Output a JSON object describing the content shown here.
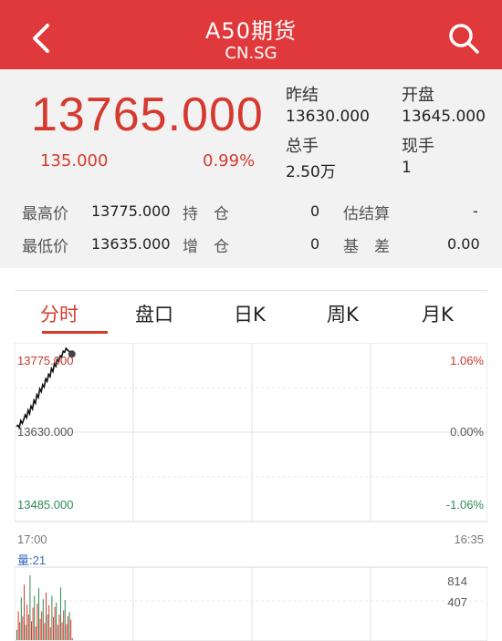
{
  "header": {
    "title": "A50期货",
    "code": "CN.SG"
  },
  "quote": {
    "price": "13765.000",
    "change": "135.000",
    "change_pct": "0.99%",
    "prev_settle_label": "昨结",
    "prev_settle_value": "13630.000",
    "open_label": "开盘",
    "open_value": "13645.000",
    "volume_label": "总手",
    "volume_value": "2.50万",
    "current_label": "现手",
    "current_value": "1"
  },
  "stats": {
    "high_label": "最高价",
    "high_value": "13775.000",
    "position_label": "持　仓",
    "position_value": "0",
    "est_settle_label": "估结算",
    "est_settle_value": "-",
    "low_label": "最低价",
    "low_value": "13635.000",
    "increase_label": "增　仓",
    "increase_value": "0",
    "basis_label": "基　差",
    "basis_value": "0.00"
  },
  "tabs": [
    "分时",
    "盘口",
    "日K",
    "周K",
    "月K"
  ],
  "chart_data": {
    "type": "line",
    "y_top_label": "13775.000",
    "y_mid_label": "13630.000",
    "y_bottom_label": "13485.000",
    "pct_top": "1.06%",
    "pct_mid": "0.00%",
    "pct_bottom": "-1.06%",
    "time_start": "17:00",
    "time_end": "16:35",
    "volume_label": "量:21",
    "vol_top": "814",
    "vol_mid": "407",
    "ylim": [
      13485,
      13775
    ],
    "price_series": [
      13640,
      13642,
      13638,
      13650,
      13645,
      13652,
      13660,
      13655,
      13668,
      13662,
      13675,
      13670,
      13685,
      13680,
      13695,
      13690,
      13705,
      13700,
      13712,
      13708,
      13722,
      13718,
      13730,
      13726,
      13740,
      13735,
      13748,
      13744,
      13756,
      13752,
      13762,
      13760,
      13770,
      13768,
      13775,
      13772,
      13770,
      13766,
      13765
    ],
    "volume_series": [
      120,
      340,
      210,
      500,
      280,
      650,
      180,
      420,
      300,
      760,
      220,
      380,
      520,
      160,
      430,
      610,
      250,
      340,
      480,
      200,
      560,
      300,
      410,
      150,
      520,
      270,
      390,
      440,
      180,
      300,
      620,
      210,
      350,
      470,
      190,
      280,
      330,
      240,
      21
    ]
  },
  "colors": {
    "brand": "#e0393b",
    "up": "#d63a2f",
    "down": "#2e8b57"
  }
}
